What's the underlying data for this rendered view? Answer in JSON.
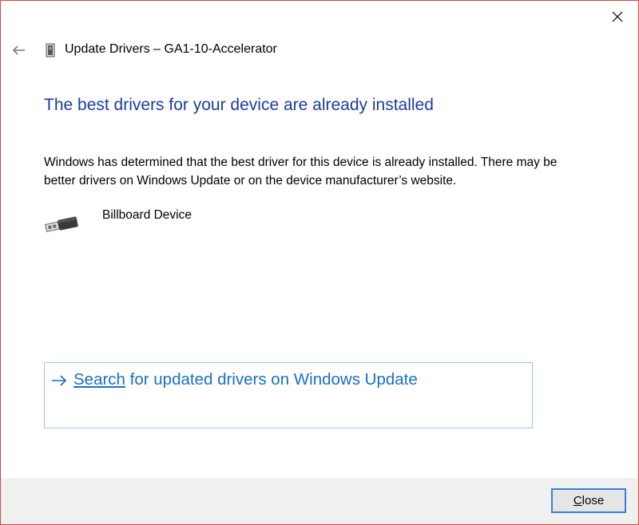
{
  "window": {
    "close_icon": "close-icon",
    "accent_border": "#e04343"
  },
  "titlebar": {
    "back_icon": "back-arrow-icon",
    "app_icon": "device-manager-icon",
    "title": "Update Drivers – GA1-10-Accelerator"
  },
  "main": {
    "heading": "The best drivers for your device are already installed",
    "heading_color": "#1c3d9e",
    "description": "Windows has determined that the best driver for this device is already installed. There may be better drivers on Windows Update or on the device manufacturer’s website.",
    "device": {
      "icon": "usb-connector-icon",
      "name": "Billboard Device"
    },
    "link": {
      "icon": "right-arrow-icon",
      "label_first": "Search",
      "label_rest": " for updated drivers on Windows Update",
      "color": "#1a6fc4"
    }
  },
  "footer": {
    "close_label_underlined": "C",
    "close_label_rest": "lose"
  }
}
